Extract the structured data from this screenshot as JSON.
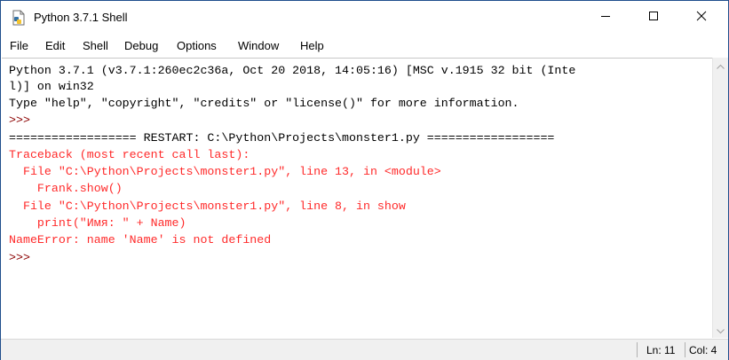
{
  "window": {
    "title": "Python 3.7.1 Shell",
    "border_color": "#1f4e8c"
  },
  "menu": [
    "File",
    "Edit",
    "Shell",
    "Debug",
    "Options",
    "Window",
    "Help"
  ],
  "editor": {
    "lines": [
      {
        "text": "Python 3.7.1 (v3.7.1:260ec2c36a, Oct 20 2018, 14:05:16) [MSC v.1915 32 bit (Inte",
        "style": "black"
      },
      {
        "text": "l)] on win32",
        "style": "black"
      },
      {
        "text": "Type \"help\", \"copyright\", \"credits\" or \"license()\" for more information.",
        "style": "black"
      },
      {
        "text": ">>>",
        "style": "prompt"
      },
      {
        "text": "================== RESTART: C:\\Python\\Projects\\monster1.py ==================",
        "style": "black"
      },
      {
        "text": "Traceback (most recent call last):",
        "style": "red"
      },
      {
        "text": "  File \"C:\\Python\\Projects\\monster1.py\", line 13, in <module>",
        "style": "red"
      },
      {
        "text": "    Frank.show()",
        "style": "red"
      },
      {
        "text": "  File \"C:\\Python\\Projects\\monster1.py\", line 8, in show",
        "style": "red"
      },
      {
        "text": "    print(\"Имя: \" + Name)",
        "style": "red"
      },
      {
        "text": "NameError: name 'Name' is not defined",
        "style": "red"
      },
      {
        "text": ">>>",
        "style": "prompt"
      }
    ],
    "colors": {
      "output": "#000000",
      "error": "#ff2a2a",
      "prompt": "#8b0000"
    }
  },
  "status": {
    "line": "Ln: 11",
    "col": "Col: 4"
  },
  "icons": {
    "app": "python-idle-icon",
    "minimize": "minimize-icon",
    "maximize": "maximize-icon",
    "close": "close-icon",
    "scroll_up": "scroll-up-arrow-icon",
    "scroll_down": "scroll-down-arrow-icon"
  }
}
